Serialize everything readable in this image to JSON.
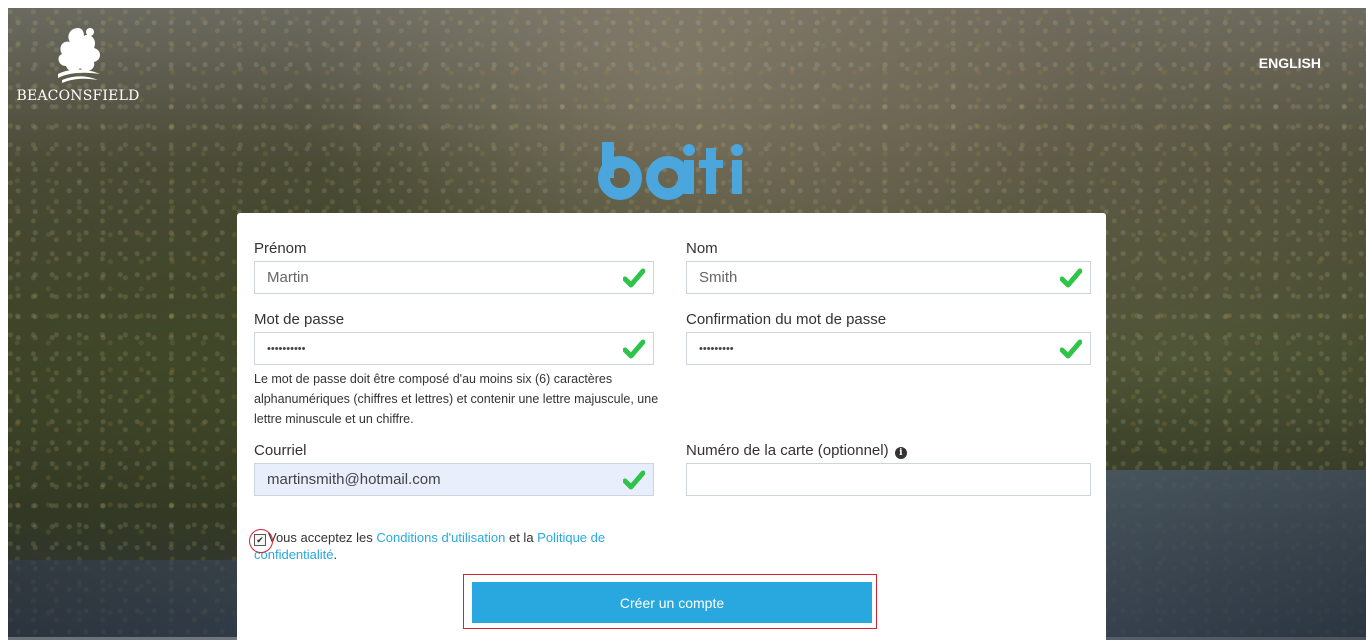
{
  "header": {
    "logo_text": "BEACONSFIELD",
    "language_link": "ENGLISH",
    "brand": "bciti"
  },
  "form": {
    "first_name": {
      "label": "Prénom",
      "value": "Martin"
    },
    "last_name": {
      "label": "Nom",
      "value": "Smith"
    },
    "password": {
      "label": "Mot de passe",
      "value": "••••••••••"
    },
    "password_confirm": {
      "label": "Confirmation du mot de passe",
      "value": "•••••••••"
    },
    "password_hint": "Le mot de passe doit être composé d'au moins six (6) caractères alphanumériques (chiffres et lettres) et contenir une lettre majuscule, une lettre minuscule et un chiffre.",
    "email": {
      "label": "Courriel",
      "value": "martinsmith@hotmail.com"
    },
    "card_number": {
      "label": "Numéro de la carte (optionnel)",
      "value": ""
    },
    "terms": {
      "prefix": "Vous acceptez les ",
      "terms_link": "Conditions d'utilisation",
      "middle": " et la ",
      "privacy_link": "Politique de confidentialité",
      "suffix": ".",
      "checked": true
    },
    "submit_label": "Créer un compte"
  },
  "colors": {
    "accent": "#29a8e0",
    "valid": "#2ec44a",
    "highlight": "#d62232"
  }
}
